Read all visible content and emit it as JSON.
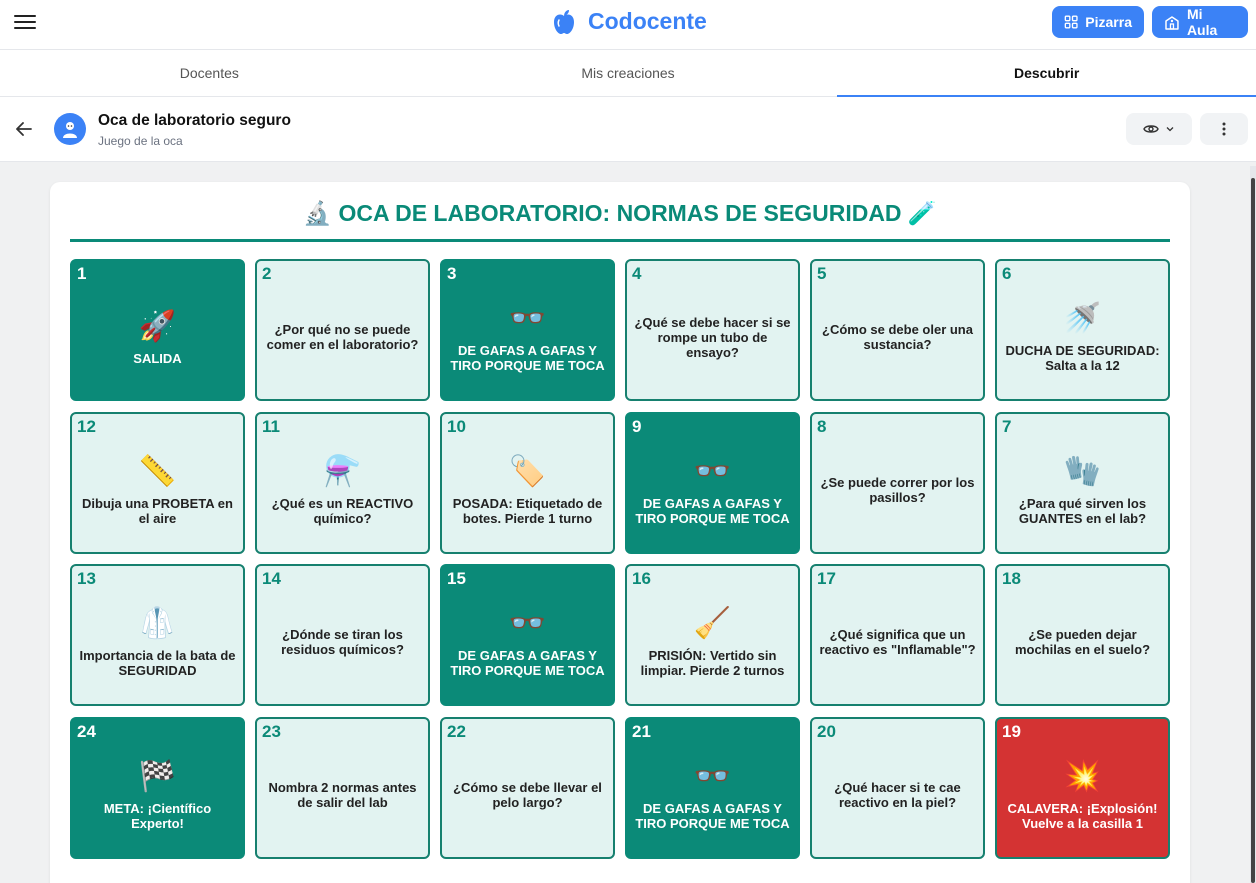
{
  "app": {
    "brand": "Codocente",
    "buttons": {
      "pizarra": "Pizarra",
      "aula": "Mi Aula"
    }
  },
  "tabs": [
    {
      "label": "Docentes",
      "active": false
    },
    {
      "label": "Mis creaciones",
      "active": false
    },
    {
      "label": "Descubrir",
      "active": true
    }
  ],
  "resource": {
    "title": "Oca de laboratorio seguro",
    "subtitle": "Juego de la oca"
  },
  "board": {
    "title": "🔬 OCA DE LABORATORIO: NORMAS DE SEGURIDAD 🧪",
    "cells": [
      {
        "num": "1",
        "icon": "🚀",
        "text": "SALIDA",
        "style": "dark"
      },
      {
        "num": "2",
        "icon": "",
        "text": "¿Por qué no se puede comer en el laboratorio?",
        "style": "light"
      },
      {
        "num": "3",
        "icon": "👓",
        "text": "DE GAFAS A GAFAS Y TIRO PORQUE ME TOCA",
        "style": "dark"
      },
      {
        "num": "4",
        "icon": "",
        "text": "¿Qué se debe hacer si se rompe un tubo de ensayo?",
        "style": "light"
      },
      {
        "num": "5",
        "icon": "",
        "text": "¿Cómo se debe oler una sustancia?",
        "style": "light"
      },
      {
        "num": "6",
        "icon": "🚿",
        "text": "DUCHA DE SEGURIDAD: Salta a la 12",
        "style": "light"
      },
      {
        "num": "12",
        "icon": "📏",
        "text": "Dibuja una PROBETA en el aire",
        "style": "light"
      },
      {
        "num": "11",
        "icon": "⚗️",
        "text": "¿Qué es un REACTIVO químico?",
        "style": "light"
      },
      {
        "num": "10",
        "icon": "🏷️",
        "text": "POSADA: Etiquetado de botes. Pierde 1 turno",
        "style": "light"
      },
      {
        "num": "9",
        "icon": "👓",
        "text": "DE GAFAS A GAFAS Y TIRO PORQUE ME TOCA",
        "style": "dark"
      },
      {
        "num": "8",
        "icon": "",
        "text": "¿Se puede correr por los pasillos?",
        "style": "light"
      },
      {
        "num": "7",
        "icon": "🧤",
        "text": "¿Para qué sirven los GUANTES en el lab?",
        "style": "light"
      },
      {
        "num": "13",
        "icon": "🥼",
        "text": "Importancia de la bata de SEGURIDAD",
        "style": "light"
      },
      {
        "num": "14",
        "icon": "",
        "text": "¿Dónde se tiran los residuos químicos?",
        "style": "light"
      },
      {
        "num": "15",
        "icon": "👓",
        "text": "DE GAFAS A GAFAS Y TIRO PORQUE ME TOCA",
        "style": "dark"
      },
      {
        "num": "16",
        "icon": "🧹",
        "text": "PRISIÓN: Vertido sin limpiar. Pierde 2 turnos",
        "style": "light"
      },
      {
        "num": "17",
        "icon": "",
        "text": "¿Qué significa que un reactivo es \"Inflamable\"?",
        "style": "light"
      },
      {
        "num": "18",
        "icon": "",
        "text": "¿Se pueden dejar mochilas en el suelo?",
        "style": "light"
      },
      {
        "num": "24",
        "icon": "🏁",
        "text": "META: ¡Científico Experto!",
        "style": "dark"
      },
      {
        "num": "23",
        "icon": "",
        "text": "Nombra 2 normas antes de salir del lab",
        "style": "light"
      },
      {
        "num": "22",
        "icon": "",
        "text": "¿Cómo se debe llevar el pelo largo?",
        "style": "light"
      },
      {
        "num": "21",
        "icon": "👓",
        "text": "DE GAFAS A GAFAS Y TIRO PORQUE ME TOCA",
        "style": "dark"
      },
      {
        "num": "20",
        "icon": "",
        "text": "¿Qué hacer si te cae reactivo en la piel?",
        "style": "light"
      },
      {
        "num": "19",
        "icon": "💥",
        "text": "CALAVERA: ¡Explosión! Vuelve a la casilla 1",
        "style": "red"
      }
    ]
  }
}
